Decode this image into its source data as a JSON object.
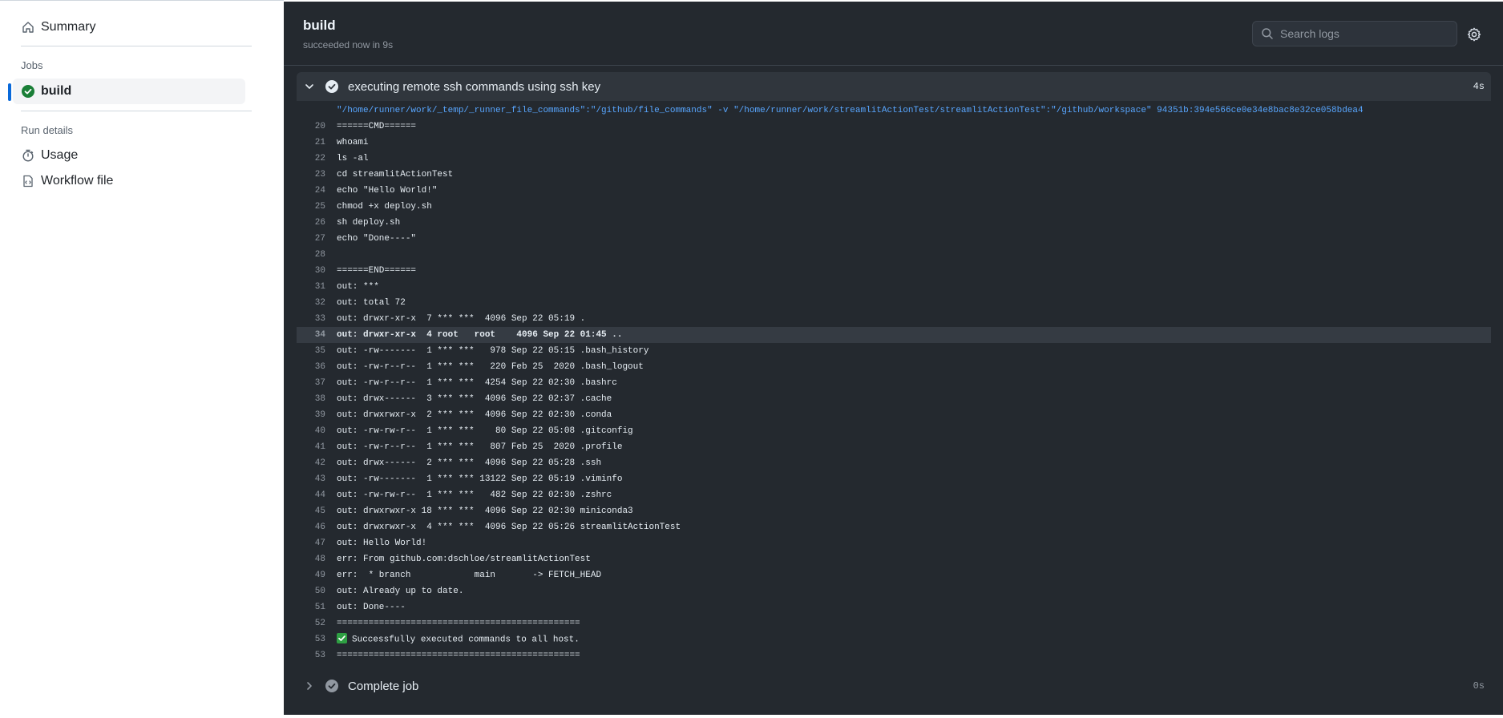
{
  "sidebar": {
    "summary_label": "Summary",
    "jobs_heading": "Jobs",
    "job_label": "build",
    "run_details_heading": "Run details",
    "usage_label": "Usage",
    "workflow_file_label": "Workflow file"
  },
  "header": {
    "title": "build",
    "subtitle": "succeeded now in 9s",
    "search_placeholder": "Search logs"
  },
  "steps": [
    {
      "label": "executing remote ssh commands using ssh key",
      "duration": "4s",
      "expanded": true
    },
    {
      "label": "Complete job",
      "duration": "0s",
      "expanded": false
    }
  ],
  "log_lines": [
    {
      "num": "",
      "text": "\"/home/runner/work/_temp/_runner_file_commands\":\"/github/file_commands\" -v \"/home/runner/work/streamlitActionTest/streamlitActionTest\":\"/github/workspace\" 94351b:394e566ce0e34e8bac8e32ce058bdea4"
    },
    {
      "num": "20",
      "text": "======CMD======"
    },
    {
      "num": "21",
      "text": "whoami"
    },
    {
      "num": "22",
      "text": "ls -al"
    },
    {
      "num": "23",
      "text": "cd streamlitActionTest"
    },
    {
      "num": "24",
      "text": "echo \"Hello World!\""
    },
    {
      "num": "25",
      "text": "chmod +x deploy.sh"
    },
    {
      "num": "26",
      "text": "sh deploy.sh"
    },
    {
      "num": "27",
      "text": "echo \"Done----\""
    },
    {
      "num": "28",
      "text": ""
    },
    {
      "num": "30",
      "text": "======END======"
    },
    {
      "num": "31",
      "text": "out: ***"
    },
    {
      "num": "32",
      "text": "out: total 72"
    },
    {
      "num": "33",
      "text": "out: drwxr-xr-x  7 *** ***  4096 Sep 22 05:19 ."
    },
    {
      "num": "34",
      "text": "out: drwxr-xr-x  4 root   root    4096 Sep 22 01:45 .."
    },
    {
      "num": "35",
      "text": "out: -rw-------  1 *** ***   978 Sep 22 05:15 .bash_history"
    },
    {
      "num": "36",
      "text": "out: -rw-r--r--  1 *** ***   220 Feb 25  2020 .bash_logout"
    },
    {
      "num": "37",
      "text": "out: -rw-r--r--  1 *** ***  4254 Sep 22 02:30 .bashrc"
    },
    {
      "num": "38",
      "text": "out: drwx------  3 *** ***  4096 Sep 22 02:37 .cache"
    },
    {
      "num": "39",
      "text": "out: drwxrwxr-x  2 *** ***  4096 Sep 22 02:30 .conda"
    },
    {
      "num": "40",
      "text": "out: -rw-rw-r--  1 *** ***    80 Sep 22 05:08 .gitconfig"
    },
    {
      "num": "41",
      "text": "out: -rw-r--r--  1 *** ***   807 Feb 25  2020 .profile"
    },
    {
      "num": "42",
      "text": "out: drwx------  2 *** ***  4096 Sep 22 05:28 .ssh"
    },
    {
      "num": "43",
      "text": "out: -rw-------  1 *** *** 13122 Sep 22 05:19 .viminfo"
    },
    {
      "num": "44",
      "text": "out: -rw-rw-r--  1 *** ***   482 Sep 22 02:30 .zshrc"
    },
    {
      "num": "45",
      "text": "out: drwxrwxr-x 18 *** ***  4096 Sep 22 02:30 miniconda3"
    },
    {
      "num": "46",
      "text": "out: drwxrwxr-x  4 *** ***  4096 Sep 22 05:26 streamlitActionTest"
    },
    {
      "num": "47",
      "text": "out: Hello World!"
    },
    {
      "num": "48",
      "text": "err: From github.com:dschloe/streamlitActionTest"
    },
    {
      "num": "49",
      "text": "err:  * branch            main       -> FETCH_HEAD"
    },
    {
      "num": "50",
      "text": "out: Already up to date."
    },
    {
      "num": "51",
      "text": "out: Done----"
    },
    {
      "num": "52",
      "text": "=============================================="
    },
    {
      "num": "53",
      "text": "Successfully executed commands to all host."
    },
    {
      "num": "53",
      "text": "=============================================="
    }
  ],
  "highlighted_line": "34",
  "success_line_index": 33,
  "colors": {
    "panel_bg": "#24292f",
    "success_green": "#2ea043",
    "accent_blue": "#0969da",
    "link_blue": "#58a6ff"
  },
  "icons": [
    "home-icon",
    "check-circle-icon",
    "stopwatch-icon",
    "workflow-file-icon",
    "search-icon",
    "gear-icon",
    "chevron-down-icon",
    "chevron-right-icon",
    "check-circle-icon",
    "check-box-icon"
  ]
}
